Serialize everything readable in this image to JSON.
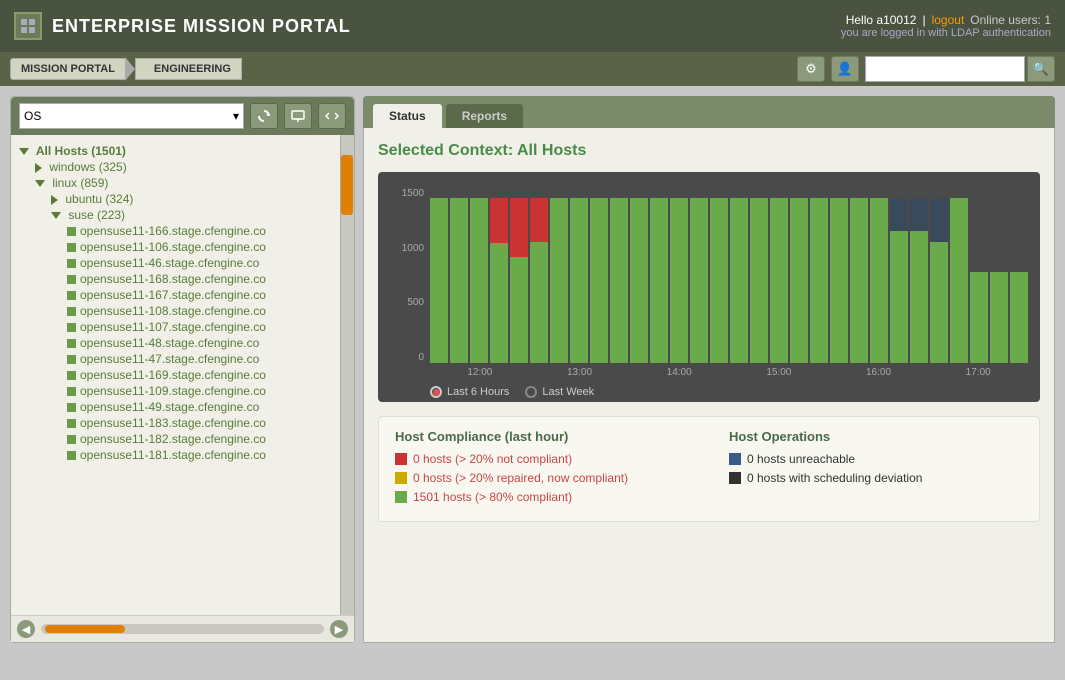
{
  "header": {
    "title": "ENTERPRISE MISSION PORTAL",
    "hello": "Hello a10012",
    "logout_label": "logout",
    "online_users": "Online users: 1",
    "auth_text": "you are logged in with LDAP authentication"
  },
  "navbar": {
    "breadcrumb1": "MISSION PORTAL",
    "breadcrumb2": "ENGINEERING",
    "search_placeholder": ""
  },
  "toolbar": {
    "os_label": "OS",
    "dropdown_arrow": "▾"
  },
  "tree": {
    "root_label": "All Hosts (1501)",
    "items": [
      {
        "indent": 1,
        "type": "collapsed",
        "label": "windows (325)"
      },
      {
        "indent": 1,
        "type": "expanded",
        "label": "linux (859)"
      },
      {
        "indent": 2,
        "type": "collapsed",
        "label": "ubuntu (324)"
      },
      {
        "indent": 2,
        "type": "expanded",
        "label": "suse (223)"
      },
      {
        "indent": 3,
        "type": "host",
        "label": "opensuse11-166.stage.cfengine.co"
      },
      {
        "indent": 3,
        "type": "host",
        "label": "opensuse11-106.stage.cfengine.co"
      },
      {
        "indent": 3,
        "type": "host",
        "label": "opensuse11-46.stage.cfengine.co"
      },
      {
        "indent": 3,
        "type": "host",
        "label": "opensuse11-168.stage.cfengine.co"
      },
      {
        "indent": 3,
        "type": "host",
        "label": "opensuse11-167.stage.cfengine.co"
      },
      {
        "indent": 3,
        "type": "host",
        "label": "opensuse11-108.stage.cfengine.co"
      },
      {
        "indent": 3,
        "type": "host",
        "label": "opensuse11-107.stage.cfengine.co"
      },
      {
        "indent": 3,
        "type": "host",
        "label": "opensuse11-48.stage.cfengine.co"
      },
      {
        "indent": 3,
        "type": "host",
        "label": "opensuse11-47.stage.cfengine.co"
      },
      {
        "indent": 3,
        "type": "host",
        "label": "opensuse11-169.stage.cfengine.co"
      },
      {
        "indent": 3,
        "type": "host",
        "label": "opensuse11-109.stage.cfengine.co"
      },
      {
        "indent": 3,
        "type": "host",
        "label": "opensuse11-49.stage.cfengine.co"
      },
      {
        "indent": 3,
        "type": "host",
        "label": "opensuse11-183.stage.cfengine.co"
      },
      {
        "indent": 3,
        "type": "host",
        "label": "opensuse11-182.stage.cfengine.co"
      },
      {
        "indent": 3,
        "type": "host",
        "label": "opensuse11-181.stage.cfengine.co"
      }
    ]
  },
  "tabs": [
    {
      "id": "status",
      "label": "Status",
      "active": true
    },
    {
      "id": "reports",
      "label": "Reports",
      "active": false
    }
  ],
  "main": {
    "context_title": "Selected Context: All Hosts",
    "chart": {
      "y_labels": [
        "1500",
        "1000",
        "500",
        "0"
      ],
      "x_labels": [
        "12:00",
        "13:00",
        "14:00",
        "15:00",
        "16:00",
        "17:00"
      ],
      "legend_last6hours": "Last 6 Hours",
      "legend_lastweek": "Last Week"
    },
    "compliance": {
      "title": "Host Compliance (last hour)",
      "row1": "0 hosts (> 20% not compliant)",
      "row2": "0 hosts (> 20% repaired, now compliant)",
      "row3": "1501 hosts (> 80% compliant)"
    },
    "operations": {
      "title": "Host Operations",
      "row1": "0 hosts unreachable",
      "row2": "0 hosts with scheduling deviation"
    }
  }
}
